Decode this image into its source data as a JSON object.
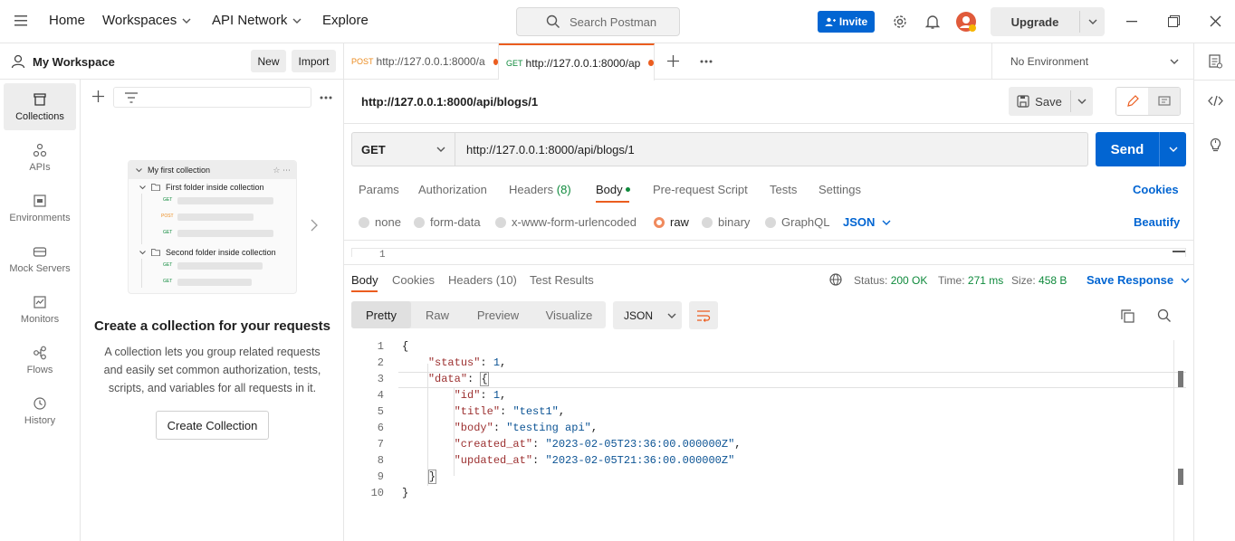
{
  "topbar": {
    "home": "Home",
    "workspaces": "Workspaces",
    "api_network": "API Network",
    "explore": "Explore",
    "search_placeholder": "Search Postman",
    "invite": "Invite",
    "upgrade": "Upgrade"
  },
  "sidebar": {
    "workspace_name": "My Workspace",
    "new_label": "New",
    "import_label": "Import",
    "rail": [
      {
        "label": "Collections",
        "icon": "collections-icon"
      },
      {
        "label": "APIs",
        "icon": "apis-icon"
      },
      {
        "label": "Environments",
        "icon": "environments-icon"
      },
      {
        "label": "Mock Servers",
        "icon": "mock-servers-icon"
      },
      {
        "label": "Monitors",
        "icon": "monitors-icon"
      },
      {
        "label": "Flows",
        "icon": "flows-icon"
      },
      {
        "label": "History",
        "icon": "history-icon"
      }
    ],
    "illustration": {
      "collection_name": "My first collection",
      "folder1": "First folder inside collection",
      "folder2": "Second folder inside collection",
      "methods": [
        "GET",
        "POST",
        "GET",
        "GET",
        "GET"
      ]
    },
    "empty_title": "Create a collection for your requests",
    "empty_desc": "A collection lets you group related requests and easily set common authorization, tests, scripts, and variables for all requests in it.",
    "create_button": "Create Collection"
  },
  "tabs": [
    {
      "method": "POST",
      "url": "http://127.0.0.1:8000/a"
    },
    {
      "method": "GET",
      "url": "http://127.0.0.1:8000/ap"
    }
  ],
  "environment": "No Environment",
  "request": {
    "title": "http://127.0.0.1:8000/api/blogs/1",
    "save_label": "Save",
    "method": "GET",
    "url": "http://127.0.0.1:8000/api/blogs/1",
    "send_label": "Send",
    "subtabs": {
      "params": "Params",
      "authorization": "Authorization",
      "headers": "Headers",
      "headers_count": "(8)",
      "body": "Body",
      "pre_request": "Pre-request Script",
      "tests": "Tests",
      "settings": "Settings",
      "cookies": "Cookies"
    },
    "body_types": {
      "none": "none",
      "form_data": "form-data",
      "urlencoded": "x-www-form-urlencoded",
      "raw": "raw",
      "binary": "binary",
      "graphql": "GraphQL",
      "format": "JSON",
      "beautify": "Beautify"
    },
    "body_line_number": "1"
  },
  "response": {
    "tabs": {
      "body": "Body",
      "cookies": "Cookies",
      "headers": "Headers",
      "headers_count": "(10)",
      "test_results": "Test Results"
    },
    "status_label": "Status:",
    "status_value": "200 OK",
    "time_label": "Time:",
    "time_value": "271 ms",
    "size_label": "Size:",
    "size_value": "458 B",
    "save_response": "Save Response",
    "view_modes": {
      "pretty": "Pretty",
      "raw": "Raw",
      "preview": "Preview",
      "visualize": "Visualize"
    },
    "format": "JSON",
    "line_numbers": [
      "1",
      "2",
      "3",
      "4",
      "5",
      "6",
      "7",
      "8",
      "9",
      "10"
    ],
    "json": {
      "status_key": "\"status\"",
      "status_val": "1",
      "data_key": "\"data\"",
      "id_key": "\"id\"",
      "id_val": "1",
      "title_key": "\"title\"",
      "title_val": "\"test1\"",
      "body_key": "\"body\"",
      "body_val": "\"testing api\"",
      "created_key": "\"created_at\"",
      "created_val": "\"2023-02-05T23:36:00.000000Z\"",
      "updated_key": "\"updated_at\"",
      "updated_val": "\"2023-02-05T21:36:00.000000Z\""
    }
  },
  "colors": {
    "accent": "#0265d2",
    "orange": "#eb5d1f",
    "status_ok": "#0f8a3c"
  }
}
